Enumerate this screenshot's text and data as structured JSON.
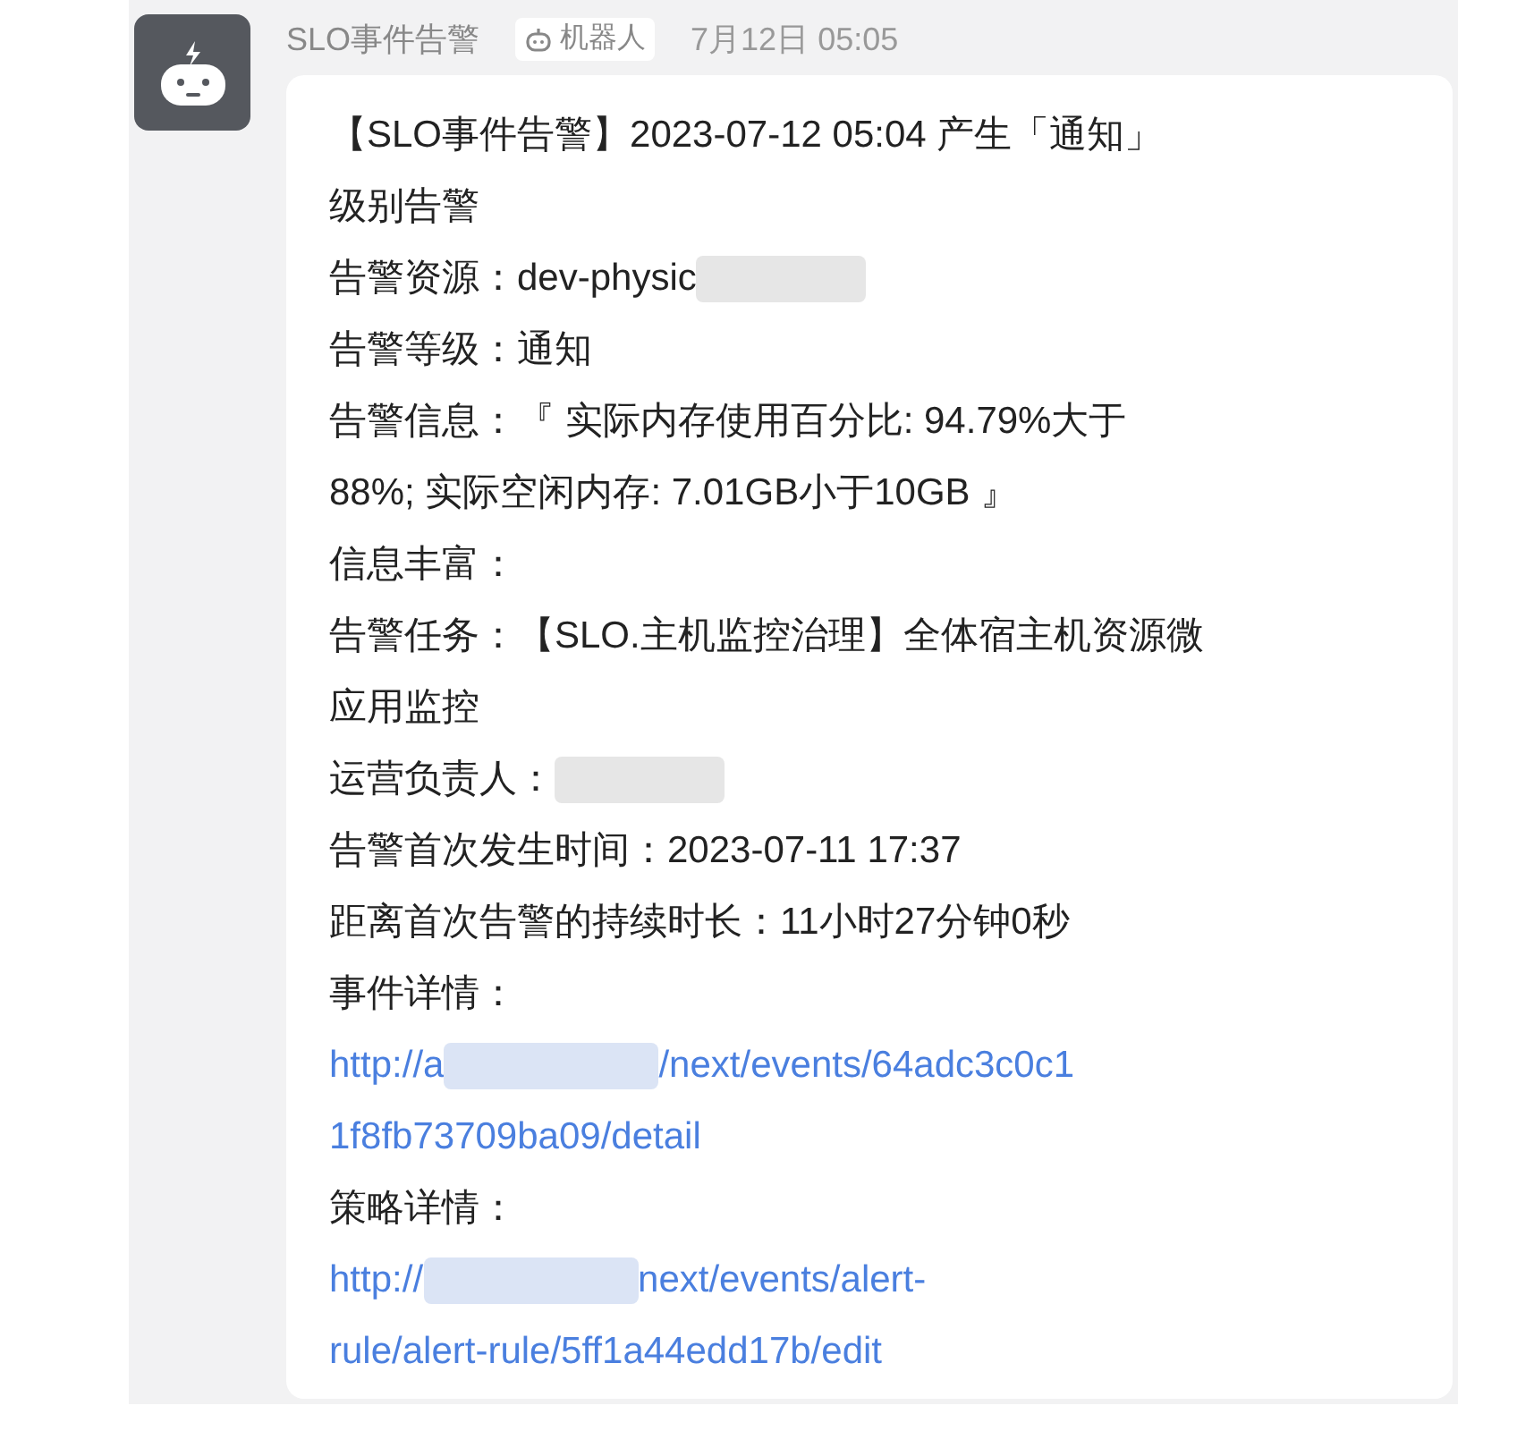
{
  "message": {
    "sender": "SLO事件告警",
    "badge": "机器人",
    "time": "7月12日 05:05",
    "lines": [
      {
        "kind": "text",
        "text": "【SLO事件告警】2023-07-12 05:04 产生「通知」"
      },
      {
        "kind": "text",
        "text": "级别告警"
      },
      {
        "kind": "text",
        "text": "告警资源：dev-physic",
        "redacted": true
      },
      {
        "kind": "text",
        "text": "告警等级：通知"
      },
      {
        "kind": "text",
        "text": "告警信息：『 实际内存使用百分比: 94.79%大于"
      },
      {
        "kind": "text",
        "text": "88%; 实际空闲内存: 7.01GB小于10GB 』"
      },
      {
        "kind": "text",
        "text": "信息丰富："
      },
      {
        "kind": "text",
        "text": "告警任务：【SLO.主机监控治理】全体宿主机资源微"
      },
      {
        "kind": "text",
        "text": "应用监控"
      },
      {
        "kind": "text",
        "text": "运营负责人：",
        "redacted": true
      },
      {
        "kind": "text",
        "text": "告警首次发生时间：2023-07-11 17:37"
      },
      {
        "kind": "text",
        "text": "距离首次告警的持续时长：11小时27分钟0秒"
      },
      {
        "kind": "text",
        "text": "事件详情："
      },
      {
        "kind": "link",
        "text": "http://a",
        "redacted": true,
        "rest": "/next/events/64adc3c0c1"
      },
      {
        "kind": "link",
        "text": "1f8fb73709ba09/detail"
      },
      {
        "kind": "text",
        "text": "策略详情："
      },
      {
        "kind": "link",
        "text": "http://",
        "redacted": true,
        "rest": "next/events/alert-"
      },
      {
        "kind": "link",
        "text": "rule/alert-rule/5ff1a44edd17b/edit"
      }
    ]
  }
}
